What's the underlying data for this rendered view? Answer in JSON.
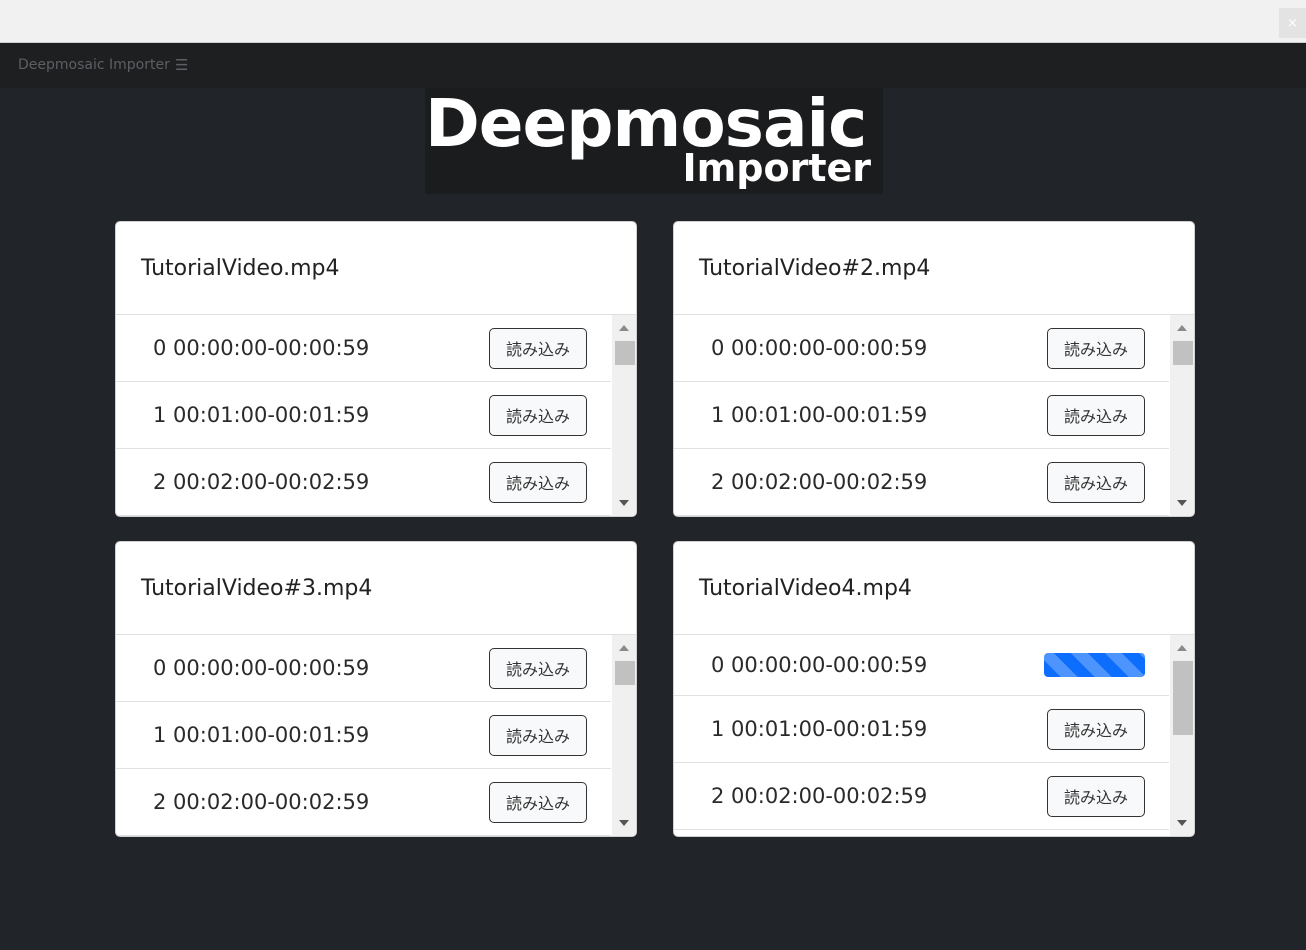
{
  "window": {
    "close_glyph": "×"
  },
  "appbar": {
    "title": "Deepmosaic Importer",
    "menu_icon": "☰"
  },
  "logo": {
    "line1": "Deepmosaic",
    "line2": "Importer"
  },
  "cards": [
    {
      "title": "TutorialVideo.mp4",
      "rows": [
        {
          "label": "0 00:00:00-00:00:59",
          "action": "読み込み"
        },
        {
          "label": "1 00:01:00-00:01:59",
          "action": "読み込み"
        },
        {
          "label": "2 00:02:00-00:02:59",
          "action": "読み込み"
        }
      ]
    },
    {
      "title": "TutorialVideo#2.mp4",
      "rows": [
        {
          "label": "0 00:00:00-00:00:59",
          "action": "読み込み"
        },
        {
          "label": "1 00:01:00-00:01:59",
          "action": "読み込み"
        },
        {
          "label": "2 00:02:00-00:02:59",
          "action": "読み込み"
        }
      ]
    },
    {
      "title": "TutorialVideo#3.mp4",
      "rows": [
        {
          "label": "0 00:00:00-00:00:59",
          "action": "読み込み"
        },
        {
          "label": "1 00:01:00-00:01:59",
          "action": "読み込み"
        },
        {
          "label": "2 00:02:00-00:02:59",
          "action": "読み込み"
        }
      ]
    },
    {
      "title": "TutorialVideo4.mp4",
      "rows": [
        {
          "label": "0 00:00:00-00:00:59",
          "action": "",
          "loading": true
        },
        {
          "label": "1 00:01:00-00:01:59",
          "action": "読み込み"
        },
        {
          "label": "2 00:02:00-00:02:59",
          "action": "読み込み"
        }
      ]
    }
  ],
  "colors": {
    "background": "#212529",
    "progress": "#0d6efd"
  }
}
